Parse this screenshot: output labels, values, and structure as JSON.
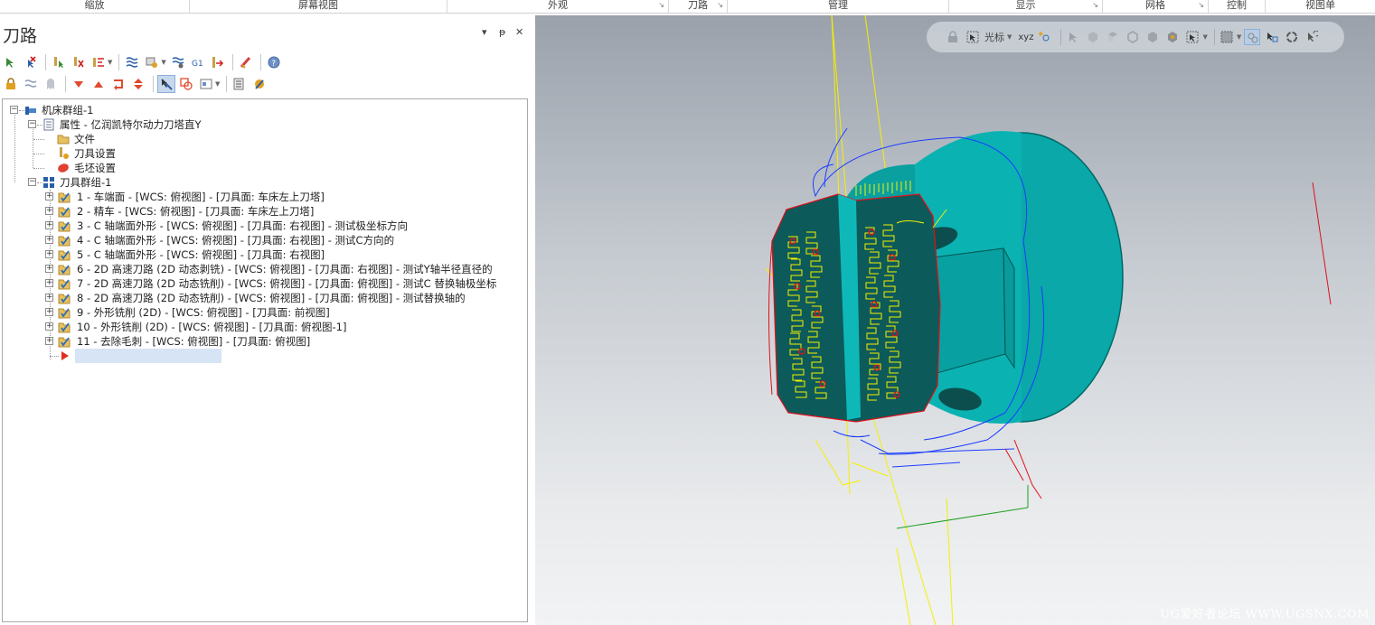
{
  "ribbon": {
    "groups": [
      {
        "label": "缩放",
        "launcher": false
      },
      {
        "label": "屏幕视图",
        "launcher": false
      },
      {
        "label": "外观",
        "launcher": true
      },
      {
        "label": "刀路",
        "launcher": true
      },
      {
        "label": "管理",
        "launcher": false
      },
      {
        "label": "显示",
        "launcher": true
      },
      {
        "label": "网格",
        "launcher": true
      },
      {
        "label": "控制",
        "launcher": false
      },
      {
        "label": "视图单",
        "launcher": false
      }
    ],
    "launcher_glyph": "↘"
  },
  "panel": {
    "title": "刀路",
    "controls": {
      "menu": "▾",
      "pin": "ᵽ",
      "close": "✕"
    },
    "toolbar_row1": [
      "select-all-ops-icon",
      "deselect-ops-icon",
      "select-dirty-ops-icon",
      "regenerate-selected-icon",
      "regenerate-dirty-icon",
      "toggle-posting-icon",
      "simulate-toolpath-icon",
      "verify-icon",
      "post-selected-icon",
      "gcode-icon",
      "high-feed-icon",
      "lock-edit-icon",
      "help-icon"
    ],
    "toolbar_row2": [
      "lock-icon",
      "toggle-display-icon",
      "toggle-posting-off-icon",
      "move-down-icon",
      "move-up-icon",
      "insert-arrow-icon",
      "expand-collapse-icon",
      "show-selected-only-icon",
      "show-associated-geometry-icon",
      "single-display-icon",
      "view-list-icon",
      "tool-check-icon"
    ]
  },
  "tree": {
    "machine_group": "机床群组-1",
    "properties": "属性 - 亿润凯特尔动力刀塔直Y",
    "property_children": [
      "文件",
      "刀具设置",
      "毛坯设置"
    ],
    "toolpath_group": "刀具群组-1",
    "operations": [
      "1 - 车端面 - [WCS: 俯视图] - [刀具面: 车床左上刀塔]",
      "2 - 精车 - [WCS: 俯视图] - [刀具面: 车床左上刀塔]",
      "3 - C 轴端面外形 - [WCS: 俯视图] - [刀具面: 右视图] - 测试极坐标方向",
      "4 - C 轴端面外形 - [WCS: 俯视图] - [刀具面: 右视图] - 测试C方向的",
      "5 - C 轴端面外形 - [WCS: 俯视图] - [刀具面: 右视图]",
      "6 - 2D 高速刀路 (2D 动态剥铣) - [WCS: 俯视图] - [刀具面: 右视图] - 测试Y轴半径直径的",
      "7 - 2D 高速刀路 (2D 动态铣削) - [WCS: 俯视图] - [刀具面: 俯视图] - 测试C  替换轴极坐标",
      "8 - 2D 高速刀路 (2D 动态铣削) - [WCS: 俯视图] - [刀具面: 俯视图] - 测试替换轴的",
      "9 - 外形铣削 (2D) - [WCS: 俯视图] - [刀具面: 前视图]",
      "10 - 外形铣削 (2D) - [WCS: 俯视图] - [刀具面: 俯视图-1]",
      "11 - 去除毛刺 - [WCS: 俯视图] - [刀具面: 俯视图]"
    ],
    "expander": "+",
    "collapser": "−"
  },
  "viewport": {
    "toolbar": {
      "cursor_label": "光标",
      "axes_label": "xyz"
    },
    "watermark": "UG爱好者论坛  WWW.UGSNX.COM"
  },
  "colors": {
    "part": "#0aa8a8",
    "toolpath": "#f5f000",
    "wire_blue": "#1a3cff",
    "wire_red": "#e0101a",
    "accent": "#2a6ebb"
  }
}
